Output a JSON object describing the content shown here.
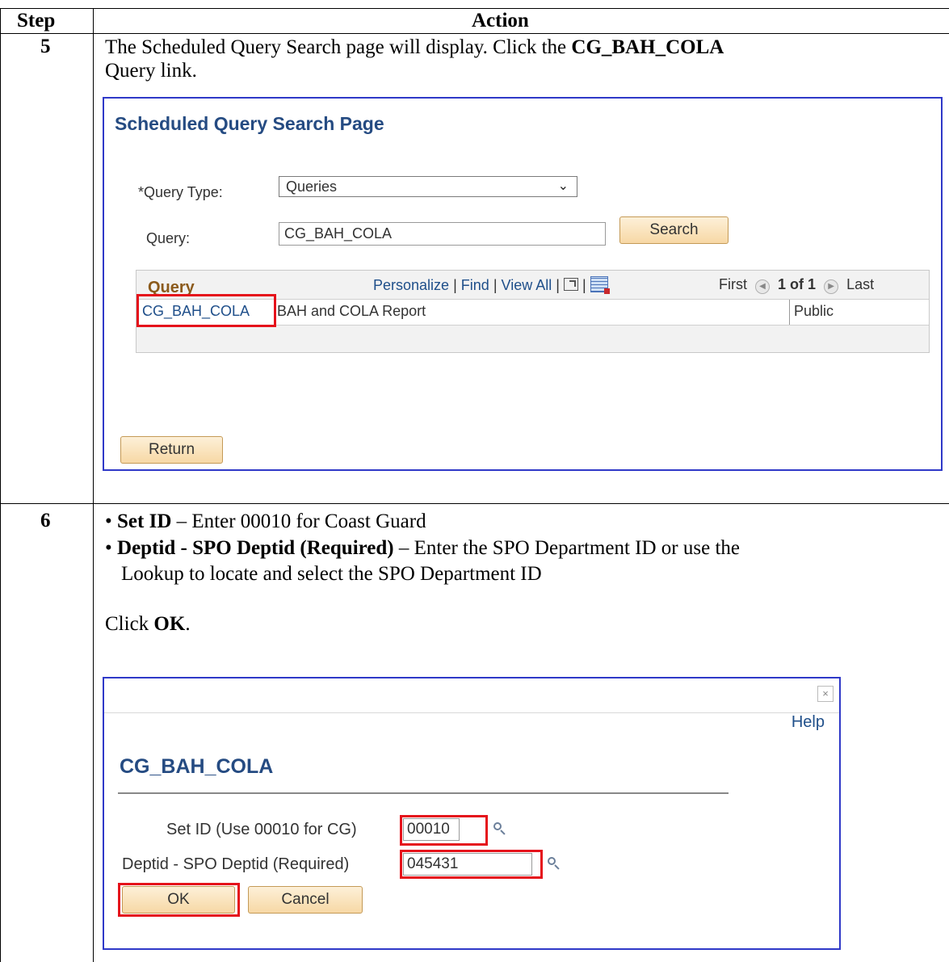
{
  "table": {
    "header_step": "Step",
    "header_action": "Action"
  },
  "step5": {
    "number": "5",
    "text_prefix": "The Scheduled Query Search page will display.  Click the ",
    "text_bold": "CG_BAH_COLA",
    "text_suffix": "Query link.",
    "screen": {
      "title": "Scheduled Query Search Page",
      "query_type_label": "*Query Type:",
      "query_type_value": "Queries",
      "query_label": "Query:",
      "query_value": "CG_BAH_COLA",
      "search_button": "Search",
      "grid": {
        "title": "Query",
        "personalize": "Personalize",
        "find": "Find",
        "view_all": "View All",
        "sep": "|",
        "first": "First",
        "range": "1 of 1",
        "last": "Last",
        "rows": [
          {
            "name": "CG_BAH_COLA",
            "description": "BAH and COLA Report",
            "access": "Public"
          }
        ]
      },
      "return_button": "Return"
    }
  },
  "step6": {
    "number": "6",
    "bullet1_bold": "Set ID",
    "bullet1_text": " – Enter 00010 for Coast Guard",
    "bullet2_bold": "Deptid - SPO Deptid (Required)",
    "bullet2_text": " – Enter the SPO Department ID or use the",
    "bullet2_cont": "Lookup to locate and select the SPO Department ID",
    "click_prefix": "Click ",
    "click_bold": "OK",
    "click_suffix": ".",
    "screen": {
      "close": "×",
      "help": "Help",
      "title": "CG_BAH_COLA",
      "setid_label": "Set ID (Use 00010 for CG)",
      "setid_value": "00010",
      "deptid_label": "Deptid - SPO Deptid (Required)",
      "deptid_value": "045431",
      "ok_button": "OK",
      "cancel_button": "Cancel"
    }
  },
  "colors": {
    "highlight": "#e5121b",
    "frame": "#2f39c8",
    "title_blue": "#254b82",
    "link_blue": "#1f4f8a"
  }
}
